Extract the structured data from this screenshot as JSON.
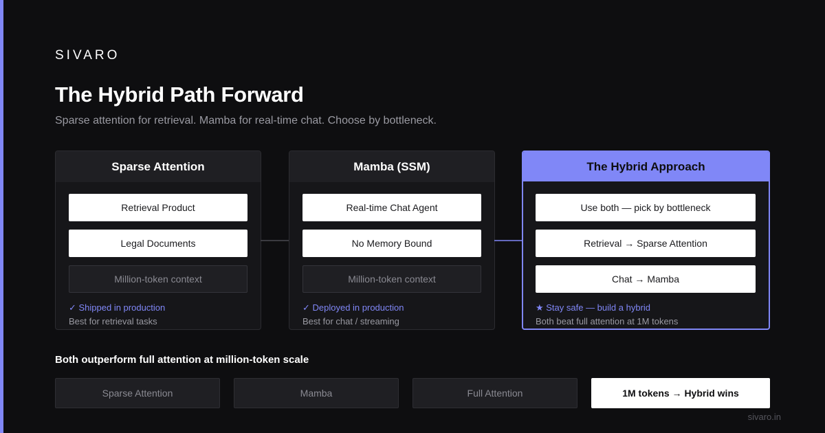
{
  "brand": "SIVARO",
  "title": "The Hybrid Path Forward",
  "subtitle": "Sparse attention for retrieval. Mamba for real-time chat. Choose by bottleneck.",
  "colors": {
    "accent": "#8087f7",
    "background": "#0e0e10",
    "card": "#161619",
    "muted": "#9a9aa2"
  },
  "cards": [
    {
      "title": "Sparse Attention",
      "items": [
        "Retrieval Product",
        "Legal Documents",
        "Million-token context"
      ],
      "status": "✓ Shipped in production",
      "note": "Best for retrieval tasks"
    },
    {
      "title": "Mamba (SSM)",
      "items": [
        "Real-time Chat Agent",
        "No Memory Bound",
        "Million-token context"
      ],
      "status": "✓ Deployed in production",
      "note": "Best for chat / streaming"
    },
    {
      "title": "The Hybrid Approach",
      "items": [
        "Use both — pick by bottleneck",
        "Retrieval → Sparse Attention",
        "Chat → Mamba"
      ],
      "status": "★ Stay safe — build a hybrid",
      "note": "Both beat full attention at 1M tokens"
    }
  ],
  "comparison": {
    "label": "Both outperform full attention at million-token scale",
    "items": [
      "Sparse Attention",
      "Mamba",
      "Full Attention",
      "1M tokens → Hybrid wins"
    ]
  },
  "footer": "sivaro.in"
}
